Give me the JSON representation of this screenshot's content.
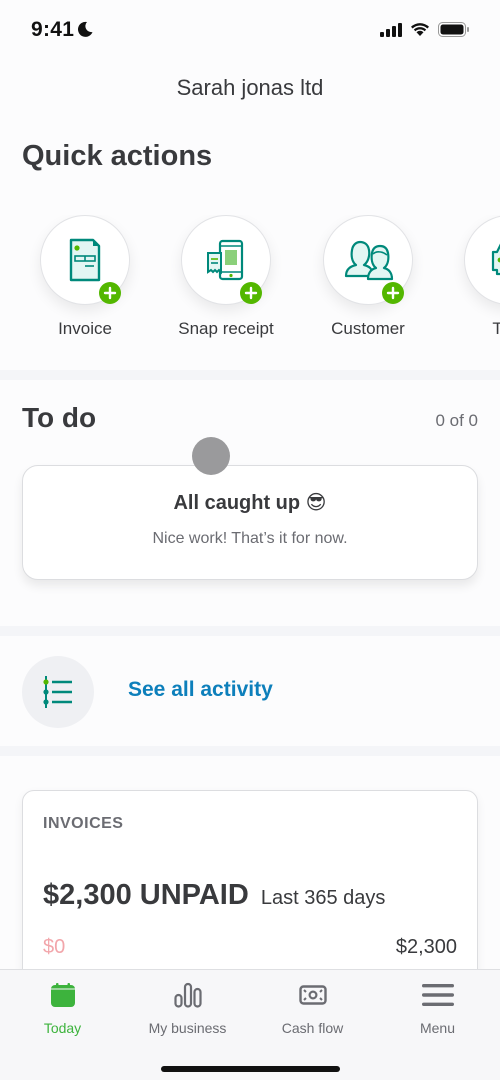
{
  "status_bar": {
    "time": "9:41",
    "icons": [
      "moon-icon",
      "signal-icon",
      "wifi-icon",
      "battery-icon"
    ]
  },
  "header": {
    "company_name": "Sarah jonas ltd"
  },
  "quick_actions": {
    "title": "Quick actions",
    "items": [
      {
        "label": "Invoice",
        "icon": "invoice-icon"
      },
      {
        "label": "Snap receipt",
        "icon": "snap-receipt-icon"
      },
      {
        "label": "Customer",
        "icon": "customer-icon"
      },
      {
        "label": "Trac",
        "icon": "track-mileage-icon"
      }
    ],
    "add_icon": "plus-icon",
    "accent_color": "#53b700",
    "icon_color": "#00897b"
  },
  "todo": {
    "title": "To do",
    "count": "0 of 0",
    "card_title": "All caught up 😎",
    "card_subtitle": "Nice work! That’s it for now."
  },
  "activity": {
    "link_label": "See all activity",
    "icon": "activity-list-icon",
    "link_color": "#0d7fbb"
  },
  "invoices": {
    "label": "INVOICES",
    "amount": "$2,300 UNPAID",
    "period": "Last 365 days",
    "min_value": "$0",
    "max_value": "$2,300"
  },
  "tabbar": {
    "active_color": "#3db33d",
    "tabs": [
      {
        "label": "Today",
        "icon": "calendar-icon",
        "active": true
      },
      {
        "label": "My business",
        "icon": "bar-chart-icon",
        "active": false
      },
      {
        "label": "Cash flow",
        "icon": "cash-icon",
        "active": false
      },
      {
        "label": "Menu",
        "icon": "hamburger-menu-icon",
        "active": false
      }
    ]
  }
}
